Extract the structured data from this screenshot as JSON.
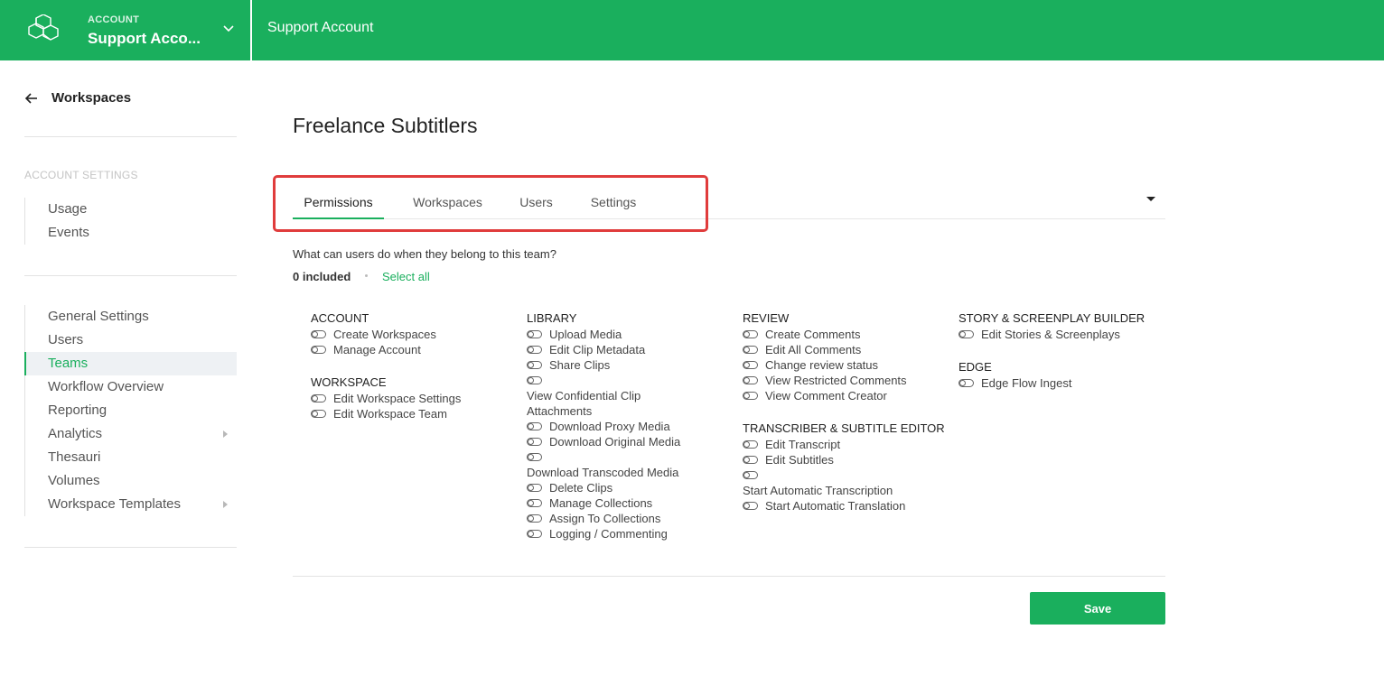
{
  "topbar": {
    "account_label": "ACCOUNT",
    "account_name": "Support Acco...",
    "title": "Support Account",
    "brand_color": "#1aaf5d"
  },
  "sidebar": {
    "back_label": "Workspaces",
    "section_title": "ACCOUNT SETTINGS",
    "group1": [
      {
        "label": "Usage"
      },
      {
        "label": "Events"
      }
    ],
    "group2": [
      {
        "label": "General Settings"
      },
      {
        "label": "Users"
      },
      {
        "label": "Teams",
        "active": true
      },
      {
        "label": "Workflow Overview"
      },
      {
        "label": "Reporting"
      },
      {
        "label": "Analytics",
        "submenu": true
      },
      {
        "label": "Thesauri"
      },
      {
        "label": "Volumes"
      },
      {
        "label": "Workspace Templates",
        "submenu": true
      }
    ]
  },
  "main": {
    "page_title": "Freelance Subtitlers",
    "tabs": [
      {
        "label": "Permissions",
        "active": true
      },
      {
        "label": "Workspaces"
      },
      {
        "label": "Users"
      },
      {
        "label": "Settings"
      }
    ],
    "question": "What can users do when they belong to this team?",
    "included": "0 included",
    "select_all": "Select all",
    "save_label": "Save",
    "highlight_color": "#e03c3c"
  },
  "permissions": {
    "col1": [
      {
        "heading": "ACCOUNT",
        "items": [
          "Create Workspaces",
          "Manage Account"
        ]
      },
      {
        "heading": "WORKSPACE",
        "items": [
          "Edit Workspace Settings",
          "Edit Workspace Team"
        ]
      }
    ],
    "col2": [
      {
        "heading": "LIBRARY",
        "items": [
          "Upload Media",
          "Edit Clip Metadata",
          "Share Clips",
          "View Confidential Clip Attachments",
          "Download Proxy Media",
          "Download Original Media",
          "Download Transcoded Media",
          "Delete Clips",
          "Manage Collections",
          "Assign To Collections",
          "Logging / Commenting"
        ]
      }
    ],
    "col3": [
      {
        "heading": "REVIEW",
        "items": [
          "Create Comments",
          "Edit All Comments",
          "Change review status",
          "View Restricted Comments",
          "View Comment Creator"
        ]
      },
      {
        "heading": "TRANSCRIBER & SUBTITLE EDITOR",
        "items": [
          "Edit Transcript",
          "Edit Subtitles",
          "Start Automatic Transcription",
          "Start Automatic Translation"
        ]
      }
    ],
    "col4": [
      {
        "heading": "STORY & SCREENPLAY BUILDER",
        "items": [
          "Edit Stories & Screenplays"
        ]
      },
      {
        "heading": "EDGE",
        "items": [
          "Edge Flow Ingest"
        ]
      }
    ]
  }
}
